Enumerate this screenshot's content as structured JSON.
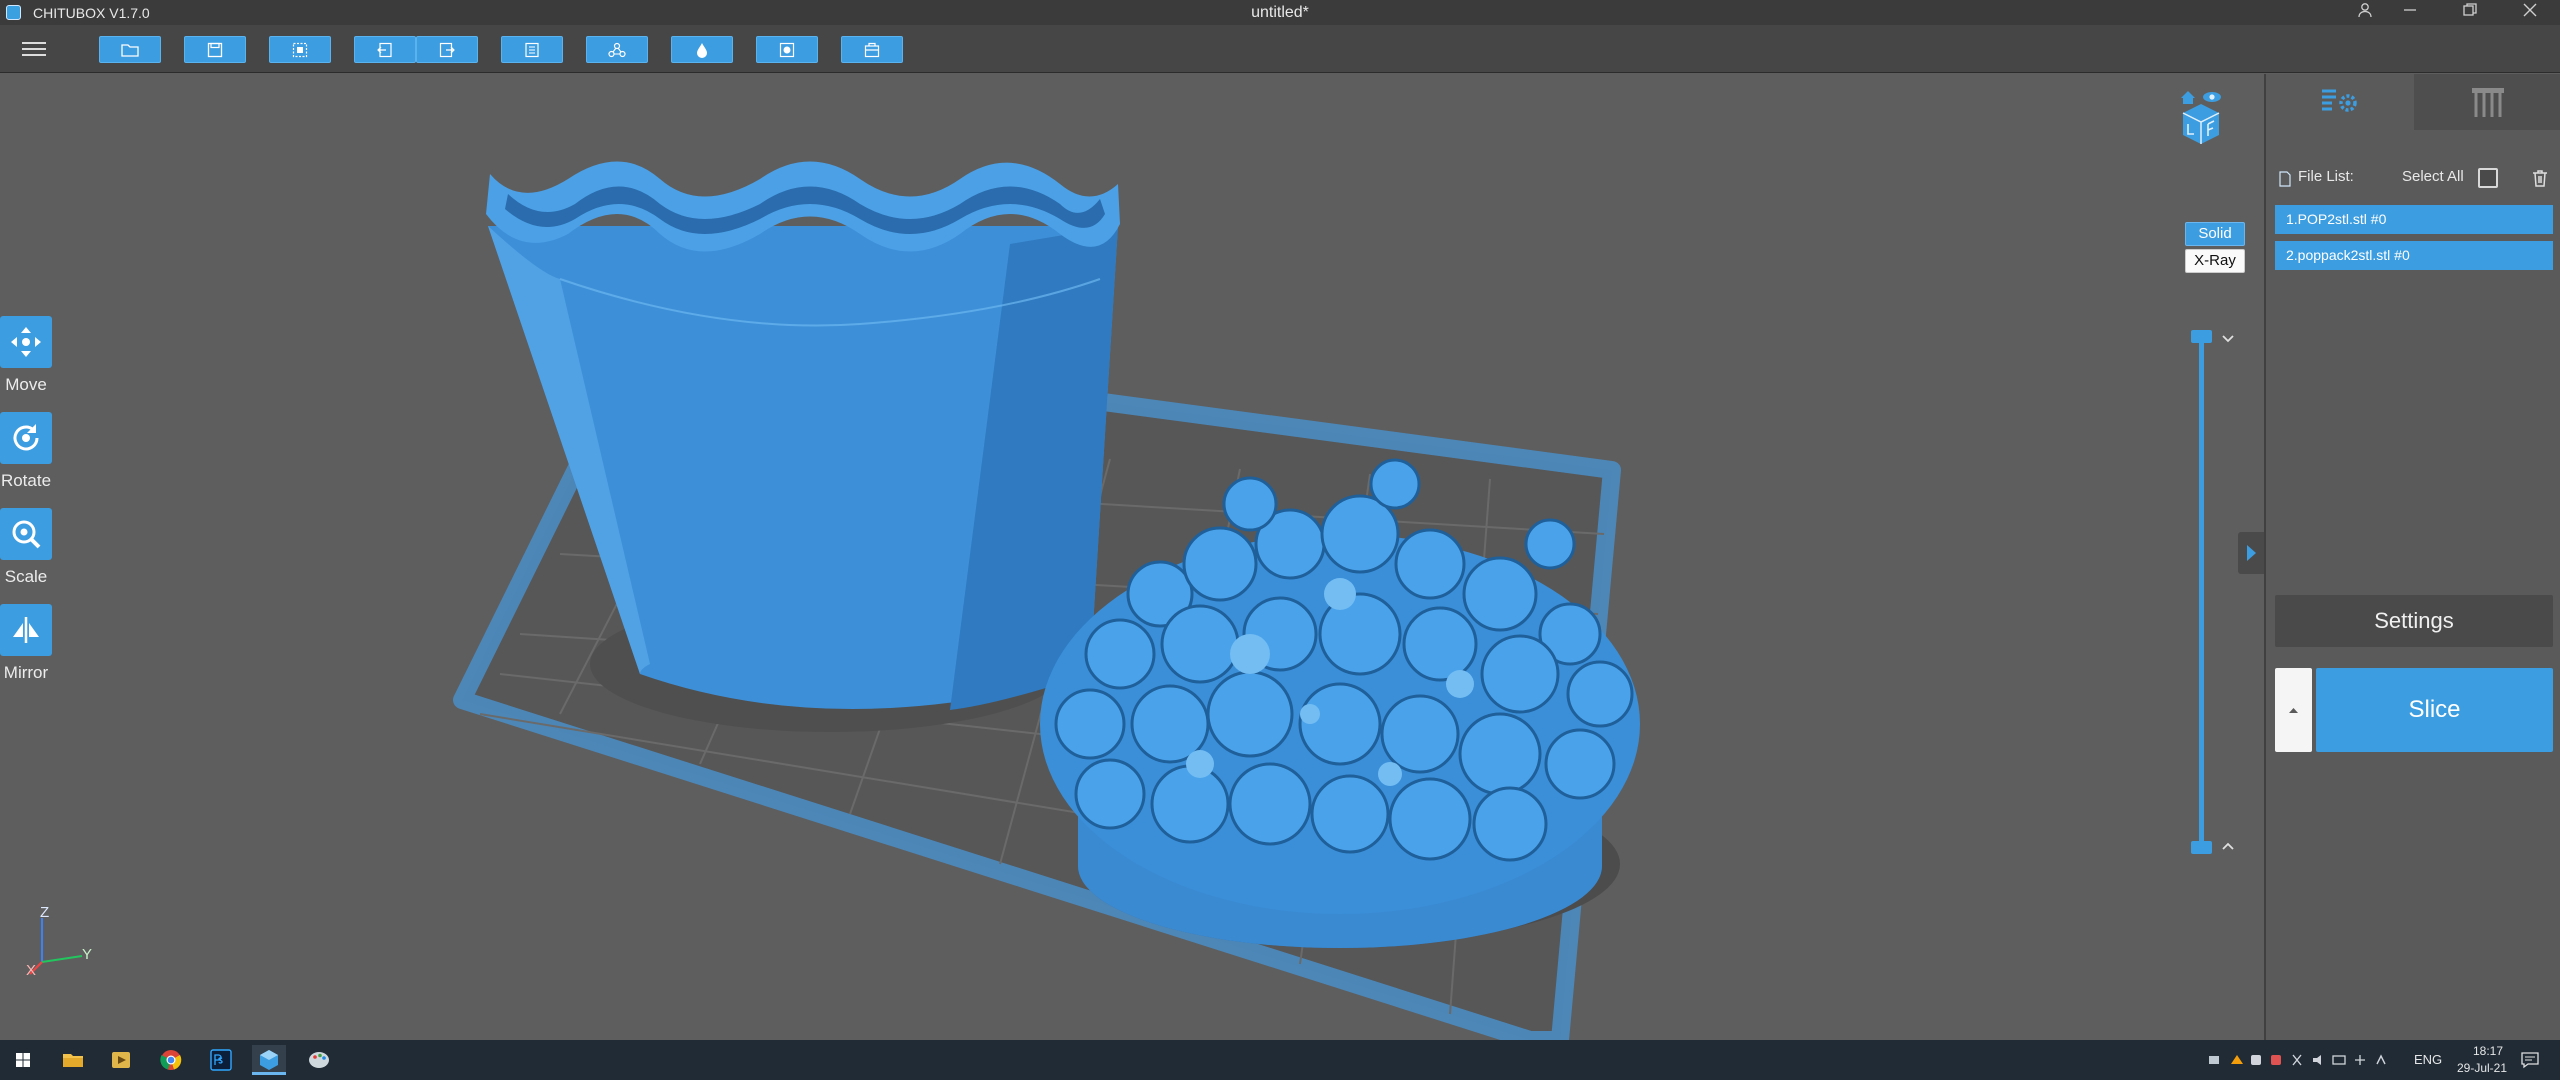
{
  "titlebar": {
    "app_title": "CHITUBOX V1.7.0",
    "doc_title": "untitled*",
    "logo_icon": "chitubox-logo-icon",
    "controls": [
      "user-icon",
      "minimize-icon",
      "restore-icon",
      "close-icon"
    ]
  },
  "toolbar": {
    "buttons": [
      "open-file-icon",
      "save-icon",
      "select-all-icon",
      "undo-icon",
      "redo-icon",
      "layout-icon",
      "supports-icon",
      "hollow-icon",
      "drill-hole-icon",
      "print-package-icon"
    ]
  },
  "left_tools": {
    "move": "Move",
    "rotate": "Rotate",
    "scale": "Scale",
    "mirror": "Mirror"
  },
  "view_mode": {
    "solid": "Solid",
    "xray": "X-Ray",
    "selected": "Solid"
  },
  "axes": {
    "x": "X",
    "y": "Y",
    "z": "Z"
  },
  "panel": {
    "tabs": [
      "settings-list-icon",
      "platform-supports-icon"
    ],
    "file_list_label": "File List:",
    "select_all_label": "Select All",
    "files": [
      "1.POP2stl.stl #0",
      "2.poppack2stl.stl #0"
    ],
    "settings_label": "Settings",
    "slice_label": "Slice"
  },
  "colors": {
    "accent": "#3c9de0",
    "viewport_bg": "#5e5e5e",
    "panel_bg": "#5a5a5a",
    "titlebar_bg": "#3b3b3b",
    "taskbar_bg": "#202b35"
  },
  "taskbar": {
    "apps": [
      "windows-start-icon",
      "file-explorer-icon",
      "media-player-icon",
      "chrome-icon",
      "photoshop-icon",
      "chitubox-icon",
      "paint-icon"
    ],
    "lang": "ENG",
    "time": "18:17",
    "date": "29-Jul-21"
  }
}
